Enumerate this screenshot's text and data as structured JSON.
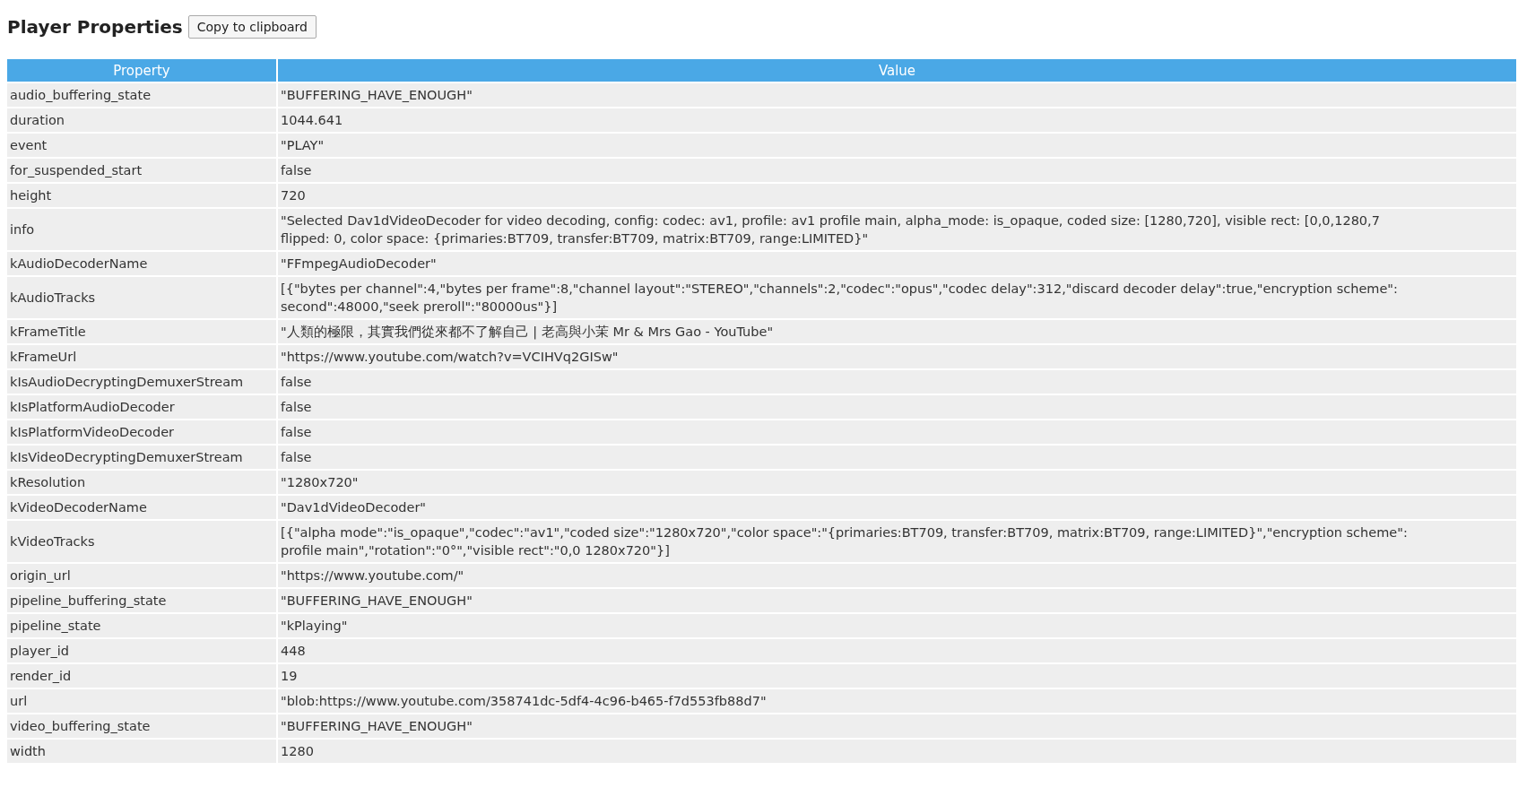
{
  "header": {
    "title": "Player Properties",
    "copy_button": "Copy to clipboard"
  },
  "table": {
    "columns": [
      "Property",
      "Value"
    ],
    "rows": [
      {
        "property": "audio_buffering_state",
        "value": [
          "\"BUFFERING_HAVE_ENOUGH\""
        ]
      },
      {
        "property": "duration",
        "value": [
          "1044.641"
        ]
      },
      {
        "property": "event",
        "value": [
          "\"PLAY\""
        ]
      },
      {
        "property": "for_suspended_start",
        "value": [
          "false"
        ]
      },
      {
        "property": "height",
        "value": [
          "720"
        ]
      },
      {
        "property": "info",
        "value": [
          "\"Selected Dav1dVideoDecoder for video decoding, config: codec: av1, profile: av1 profile main, alpha_mode: is_opaque, coded size: [1280,720], visible rect: [0,0,1280,7",
          "flipped: 0, color space: {primaries:BT709, transfer:BT709, matrix:BT709, range:LIMITED}\""
        ]
      },
      {
        "property": "kAudioDecoderName",
        "value": [
          "\"FFmpegAudioDecoder\""
        ]
      },
      {
        "property": "kAudioTracks",
        "value": [
          "[{\"bytes per channel\":4,\"bytes per frame\":8,\"channel layout\":\"STEREO\",\"channels\":2,\"codec\":\"opus\",\"codec delay\":312,\"discard decoder delay\":true,\"encryption scheme\":",
          "second\":48000,\"seek preroll\":\"80000us\"}]"
        ]
      },
      {
        "property": "kFrameTitle",
        "value": [
          "\"人類的極限，其實我們從來都不了解自己 | 老高與小茉 Mr & Mrs Gao - YouTube\""
        ]
      },
      {
        "property": "kFrameUrl",
        "value": [
          "\"https://www.youtube.com/watch?v=VCIHVq2GISw\""
        ]
      },
      {
        "property": "kIsAudioDecryptingDemuxerStream",
        "value": [
          "false"
        ]
      },
      {
        "property": "kIsPlatformAudioDecoder",
        "value": [
          "false"
        ]
      },
      {
        "property": "kIsPlatformVideoDecoder",
        "value": [
          "false"
        ]
      },
      {
        "property": "kIsVideoDecryptingDemuxerStream",
        "value": [
          "false"
        ]
      },
      {
        "property": "kResolution",
        "value": [
          "\"1280x720\""
        ]
      },
      {
        "property": "kVideoDecoderName",
        "value": [
          "\"Dav1dVideoDecoder\""
        ]
      },
      {
        "property": "kVideoTracks",
        "value": [
          "[{\"alpha mode\":\"is_opaque\",\"codec\":\"av1\",\"coded size\":\"1280x720\",\"color space\":\"{primaries:BT709, transfer:BT709, matrix:BT709, range:LIMITED}\",\"encryption scheme\":",
          "profile main\",\"rotation\":\"0°\",\"visible rect\":\"0,0 1280x720\"}]"
        ]
      },
      {
        "property": "origin_url",
        "value": [
          "\"https://www.youtube.com/\""
        ]
      },
      {
        "property": "pipeline_buffering_state",
        "value": [
          "\"BUFFERING_HAVE_ENOUGH\""
        ]
      },
      {
        "property": "pipeline_state",
        "value": [
          "\"kPlaying\""
        ]
      },
      {
        "property": "player_id",
        "value": [
          "448"
        ]
      },
      {
        "property": "render_id",
        "value": [
          "19"
        ]
      },
      {
        "property": "url",
        "value": [
          "\"blob:https://www.youtube.com/358741dc-5df4-4c96-b465-f7d553fb88d7\""
        ]
      },
      {
        "property": "video_buffering_state",
        "value": [
          "\"BUFFERING_HAVE_ENOUGH\""
        ]
      },
      {
        "property": "width",
        "value": [
          "1280"
        ]
      }
    ]
  }
}
